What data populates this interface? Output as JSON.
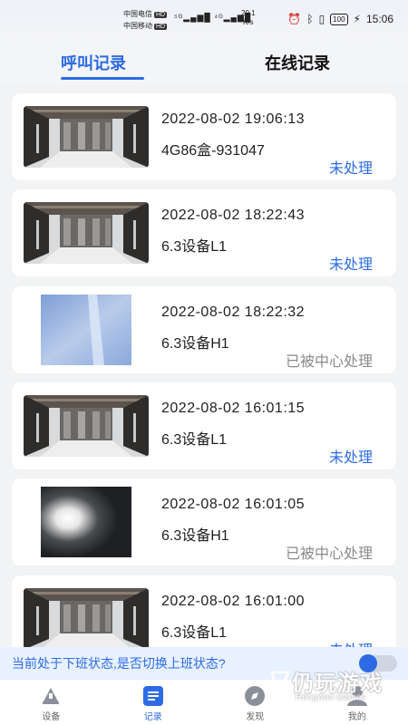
{
  "status_bar": {
    "carrier1": "中国电信",
    "carrier2": "中国移动",
    "hd": "HD",
    "signals": "⁵ᴳ▂▄▆█ ⁴ᴳ▂▄▆█",
    "net_speed": "20.1",
    "net_unit": "K/s",
    "battery": "100",
    "time": "15:06"
  },
  "tabs": [
    {
      "label": "呼叫记录",
      "active": true
    },
    {
      "label": "在线记录",
      "active": false
    }
  ],
  "records": [
    {
      "time": "2022-08-02 19:06:13",
      "device": "4G86盒-931047",
      "status": "未处理",
      "status_type": "pending",
      "thumb": "corridor"
    },
    {
      "time": "2022-08-02 18:22:43",
      "device": "6.3设备L1",
      "status": "未处理",
      "status_type": "pending",
      "thumb": "corridor"
    },
    {
      "time": "2022-08-02 18:22:32",
      "device": "6.3设备H1",
      "status": "已被中心处理",
      "status_type": "handled",
      "thumb": "blur-blue"
    },
    {
      "time": "2022-08-02 16:01:15",
      "device": "6.3设备L1",
      "status": "未处理",
      "status_type": "pending",
      "thumb": "corridor"
    },
    {
      "time": "2022-08-02 16:01:05",
      "device": "6.3设备H1",
      "status": "已被中心处理",
      "status_type": "handled",
      "thumb": "flash"
    },
    {
      "time": "2022-08-02 16:01:00",
      "device": "6.3设备L1",
      "status": "未处理",
      "status_type": "pending",
      "thumb": "corridor"
    }
  ],
  "banner": {
    "text": "当前处于下班状态,是否切换上班状态?",
    "toggle_on": false
  },
  "bottom_nav": [
    {
      "label": "设备",
      "icon": "device-icon",
      "active": false
    },
    {
      "label": "记录",
      "icon": "record-icon",
      "active": true
    },
    {
      "label": "发现",
      "icon": "discover-icon",
      "active": false
    },
    {
      "label": "我的",
      "icon": "profile-icon",
      "active": false
    }
  ],
  "watermark": {
    "main": "仍玩游戏",
    "sub": "Rengwan Games"
  },
  "colors": {
    "accent": "#2d6be4",
    "handled": "#8a8a8a",
    "banner_bg": "#e8f1ff"
  }
}
